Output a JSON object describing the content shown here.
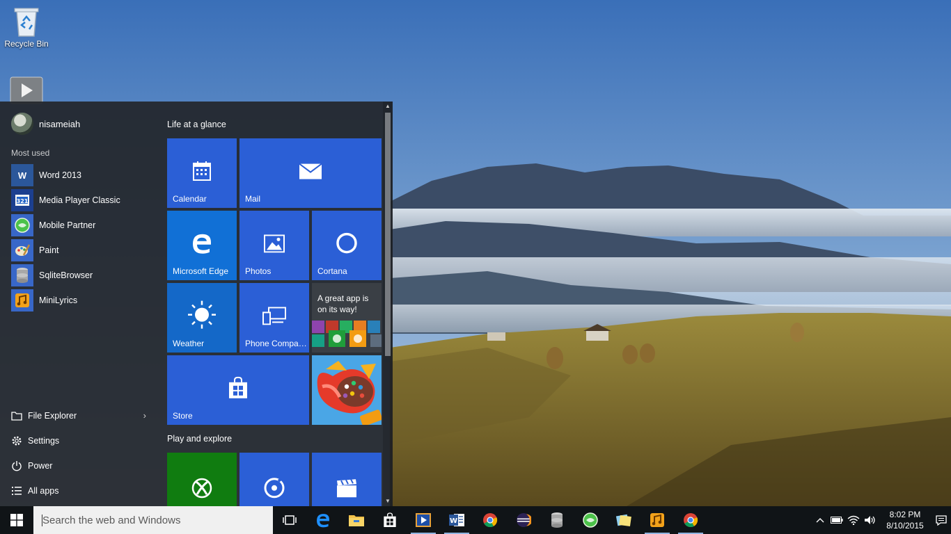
{
  "desktop": {
    "icons": [
      {
        "label": "Recycle Bin",
        "icon": "recycle-bin-icon"
      },
      {
        "label": "",
        "icon": "media-player-icon"
      }
    ]
  },
  "start_menu": {
    "user": {
      "name": "nisameiah"
    },
    "most_used_label": "Most used",
    "most_used": [
      {
        "label": "Word 2013",
        "icon": "word-icon",
        "color": "#2b579a"
      },
      {
        "label": "Media Player Classic",
        "icon": "media-player-classic-icon",
        "color": "#1c3f8f"
      },
      {
        "label": "Mobile Partner",
        "icon": "mobile-partner-icon",
        "color": "#2fa84f"
      },
      {
        "label": "Paint",
        "icon": "paint-icon",
        "color": "#3867c8"
      },
      {
        "label": "SqliteBrowser",
        "icon": "sqlitebrowser-icon",
        "color": "#3867c8"
      },
      {
        "label": "MiniLyrics",
        "icon": "minilyrics-icon",
        "color": "#f0a020"
      }
    ],
    "bottom": [
      {
        "label": "File Explorer",
        "icon": "folder-icon",
        "chevron": "›"
      },
      {
        "label": "Settings",
        "icon": "gear-icon"
      },
      {
        "label": "Power",
        "icon": "power-icon"
      },
      {
        "label": "All apps",
        "icon": "list-icon"
      }
    ],
    "groups": {
      "life": "Life at a glance",
      "play": "Play and explore"
    },
    "tiles": {
      "calendar": "Calendar",
      "mail": "Mail",
      "edge": "Microsoft Edge",
      "photos": "Photos",
      "cortana": "Cortana",
      "weather": "Weather",
      "phone": "Phone Compa…",
      "promo": "A great app is on its way!",
      "store": "Store"
    },
    "colors": {
      "tile_blue": "#2b5fd6",
      "edge_blue": "#1170d6",
      "weather_blue": "#1468c8",
      "xbox_green": "#107c10"
    }
  },
  "taskbar": {
    "search_placeholder": "Search the web and Windows",
    "apps": [
      {
        "name": "task-view-icon",
        "running": false
      },
      {
        "name": "edge-icon",
        "running": false
      },
      {
        "name": "file-explorer-icon",
        "running": false
      },
      {
        "name": "store-icon",
        "running": false
      },
      {
        "name": "media-player-classic-icon",
        "running": true
      },
      {
        "name": "word-icon",
        "running": true
      },
      {
        "name": "chrome-icon",
        "running": false
      },
      {
        "name": "eclipse-icon",
        "running": false
      },
      {
        "name": "sqlitebrowser-icon",
        "running": false
      },
      {
        "name": "mobile-partner-icon",
        "running": false
      },
      {
        "name": "sticky-notes-icon",
        "running": false
      },
      {
        "name": "minilyrics-icon",
        "running": true
      },
      {
        "name": "chrome-2-icon",
        "running": true
      }
    ],
    "tray": {
      "time": "8:02 PM",
      "date": "8/10/2015"
    }
  }
}
